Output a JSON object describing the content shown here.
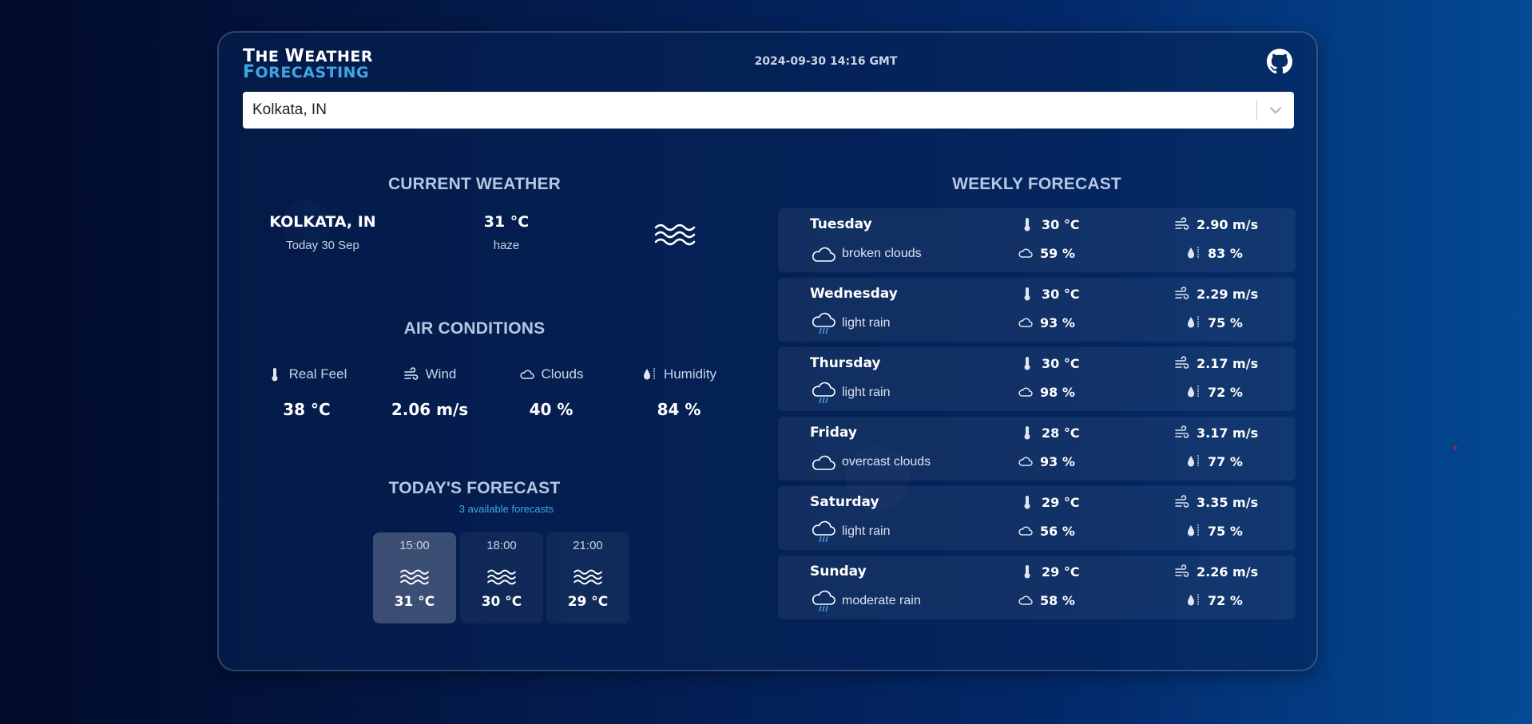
{
  "app": {
    "logo_line1_big": "T",
    "logo_line1_rest": "HE ",
    "logo_line1_big2": "W",
    "logo_line1_rest2": "EATHER",
    "logo_line2_big": "F",
    "logo_line2_rest": "ORECASTING",
    "datetime": "2024-09-30 14:16 GMT"
  },
  "search": {
    "value": "Kolkata, IN"
  },
  "current_weather": {
    "title": "CURRENT WEATHER",
    "city": "KOLKATA, IN",
    "date": "Today 30 Sep",
    "temperature": "31 °C",
    "description": "haze",
    "icon": "haze-icon"
  },
  "air_conditions": {
    "title": "AIR CONDITIONS",
    "items": [
      {
        "label": "Real Feel",
        "value": "38 °C",
        "icon": "thermometer-icon"
      },
      {
        "label": "Wind",
        "value": "2.06 m/s",
        "icon": "wind-icon"
      },
      {
        "label": "Clouds",
        "value": "40 %",
        "icon": "cloud-icon"
      },
      {
        "label": "Humidity",
        "value": "84 %",
        "icon": "humidity-icon"
      }
    ]
  },
  "todays_forecast": {
    "title": "TODAY'S FORECAST",
    "subtitle": "3 available forecasts",
    "items": [
      {
        "time": "15:00",
        "temp": "31 °C",
        "icon": "haze-icon",
        "active": true
      },
      {
        "time": "18:00",
        "temp": "30 °C",
        "icon": "haze-icon",
        "active": false
      },
      {
        "time": "21:00",
        "temp": "29 °C",
        "icon": "haze-icon",
        "active": false
      }
    ]
  },
  "weekly_forecast": {
    "title": "WEEKLY FORECAST",
    "days": [
      {
        "day": "Tuesday",
        "desc": "broken clouds",
        "icon": "cloud-icon",
        "temp": "30 °C",
        "wind": "2.90 m/s",
        "clouds": "59 %",
        "humidity": "83 %"
      },
      {
        "day": "Wednesday",
        "desc": "light rain",
        "icon": "rain-icon",
        "temp": "30 °C",
        "wind": "2.29 m/s",
        "clouds": "93 %",
        "humidity": "75 %"
      },
      {
        "day": "Thursday",
        "desc": "light rain",
        "icon": "rain-icon",
        "temp": "30 °C",
        "wind": "2.17 m/s",
        "clouds": "98 %",
        "humidity": "72 %"
      },
      {
        "day": "Friday",
        "desc": "overcast clouds",
        "icon": "cloud-icon",
        "temp": "28 °C",
        "wind": "3.17 m/s",
        "clouds": "93 %",
        "humidity": "77 %"
      },
      {
        "day": "Saturday",
        "desc": "light rain",
        "icon": "rain-icon",
        "temp": "29 °C",
        "wind": "3.35 m/s",
        "clouds": "56 %",
        "humidity": "75 %"
      },
      {
        "day": "Sunday",
        "desc": "moderate rain",
        "icon": "rain-icon",
        "temp": "29 °C",
        "wind": "2.26 m/s",
        "clouds": "58 %",
        "humidity": "72 %"
      }
    ]
  }
}
